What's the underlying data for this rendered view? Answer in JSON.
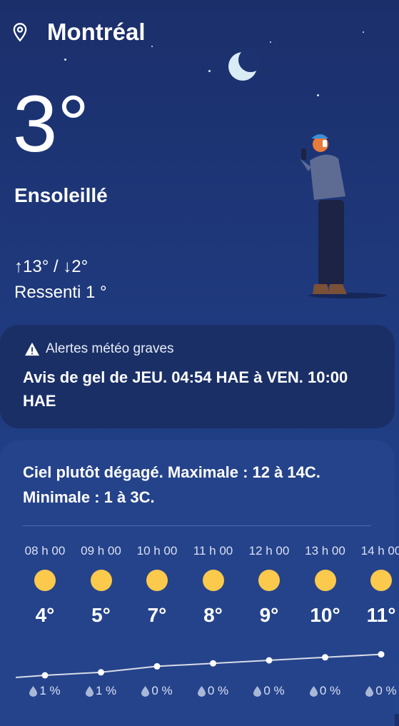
{
  "location": {
    "city": "Montréal"
  },
  "current": {
    "temperature": "3°",
    "condition": "Ensoleillé",
    "high_low": "↑13° / ↓2°",
    "feels_like": "Ressenti 1 °"
  },
  "alert": {
    "title": "Alertes météo graves",
    "message": "Avis de gel de JEU. 04:54 HAE à VEN. 10:00 HAE"
  },
  "forecast": {
    "summary": "Ciel plutôt dégagé. Maximale : 12 à 14C. Minimale : 1 à 3C.",
    "hours": [
      {
        "time": "08 h 00",
        "temp": "4°",
        "temp_value": 4,
        "precip": "1 %",
        "icon": "sun-icon"
      },
      {
        "time": "09 h 00",
        "temp": "5°",
        "temp_value": 5,
        "precip": "1 %",
        "icon": "sun-icon"
      },
      {
        "time": "10 h 00",
        "temp": "7°",
        "temp_value": 7,
        "precip": "0 %",
        "icon": "sun-icon"
      },
      {
        "time": "11 h 00",
        "temp": "8°",
        "temp_value": 8,
        "precip": "0 %",
        "icon": "sun-icon"
      },
      {
        "time": "12 h 00",
        "temp": "9°",
        "temp_value": 9,
        "precip": "0 %",
        "icon": "sun-icon"
      },
      {
        "time": "13 h 00",
        "temp": "10°",
        "temp_value": 10,
        "precip": "0 %",
        "icon": "sun-icon"
      },
      {
        "time": "14 h 00",
        "temp": "11°",
        "temp_value": 11,
        "precip": "0 %",
        "icon": "sun-icon"
      }
    ]
  },
  "colors": {
    "accent_sun": "#fbc94c",
    "card": "#1a2f66"
  }
}
